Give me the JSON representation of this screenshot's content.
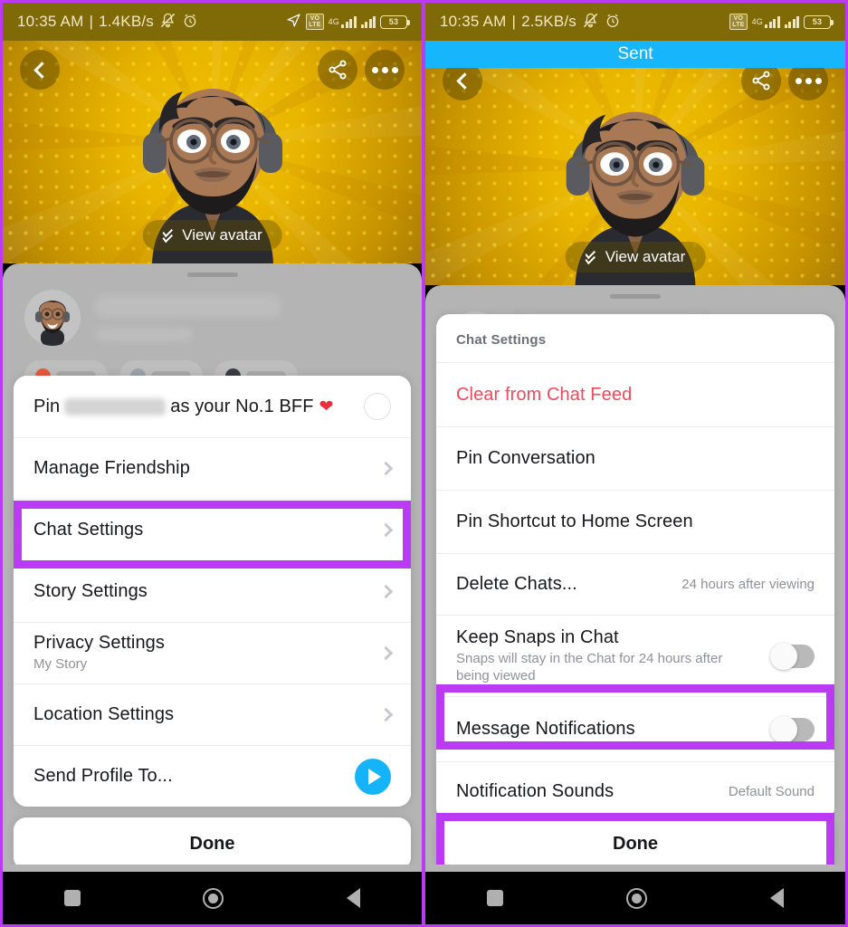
{
  "meta": {
    "accent_purple": "#BB3BF5",
    "snapchat_blue": "#15B3FA",
    "danger_red": "#F2485B"
  },
  "left_phone": {
    "status_bar": {
      "time": "10:35 AM",
      "separator": "|",
      "data_rate": "1.4KB/s",
      "mute_icon": "bell-muted-icon",
      "alarm_icon": "alarm-clock-icon",
      "location_icon": "location-arrow-icon",
      "volte_line1": "VO",
      "volte_line2": "LTE",
      "network": "4G",
      "battery_percent": "53"
    },
    "hero": {
      "back_icon": "back-chevron-icon",
      "share_icon": "share-icon",
      "more_icon": "more-options-icon",
      "view_avatar_label": "View avatar",
      "view_avatar_icon": "double-chevron-down-icon"
    },
    "menu": [
      {
        "label_prefix": "Pin",
        "label_suffix": "as your No.1 BFF",
        "name_redacted": true,
        "emoji": "❤",
        "control": "radio",
        "name": "menu-item-pin-bff"
      },
      {
        "label": "Manage Friendship",
        "control": "chevron",
        "name": "menu-item-manage-friendship"
      },
      {
        "label": "Chat Settings",
        "control": "chevron",
        "highlighted": true,
        "name": "menu-item-chat-settings"
      },
      {
        "label": "Story Settings",
        "control": "chevron",
        "name": "menu-item-story-settings"
      },
      {
        "label": "Privacy Settings",
        "sub": "My Story",
        "control": "chevron",
        "name": "menu-item-privacy-settings"
      },
      {
        "label": "Location Settings",
        "control": "chevron",
        "name": "menu-item-location-settings"
      },
      {
        "label": "Send Profile To...",
        "control": "send",
        "name": "menu-item-send-profile-to"
      }
    ],
    "done_label": "Done"
  },
  "right_phone": {
    "status_bar": {
      "time": "10:35 AM",
      "separator": "|",
      "data_rate": "2.5KB/s",
      "mute_icon": "bell-muted-icon",
      "alarm_icon": "alarm-clock-icon",
      "volte_line1": "VO",
      "volte_line2": "LTE",
      "network": "4G",
      "battery_percent": "53"
    },
    "sent_banner": "Sent",
    "hero": {
      "back_icon": "back-chevron-icon",
      "share_icon": "share-icon",
      "more_icon": "more-options-icon",
      "view_avatar_label": "View avatar",
      "view_avatar_icon": "double-chevron-down-icon"
    },
    "sheet_title": "Chat Settings",
    "menu": [
      {
        "label": "Clear from Chat Feed",
        "style": "danger",
        "name": "menu-item-clear-from-chat-feed"
      },
      {
        "label": "Pin Conversation",
        "name": "menu-item-pin-conversation"
      },
      {
        "label": "Pin Shortcut to Home Screen",
        "name": "menu-item-pin-shortcut-home-screen"
      },
      {
        "label": "Delete Chats...",
        "value": "24 hours after viewing",
        "name": "menu-item-delete-chats"
      },
      {
        "label": "Keep Snaps in Chat",
        "sub": "Snaps will stay in the Chat for 24 hours after being viewed",
        "control": "toggle",
        "toggle_on": false,
        "name": "menu-item-keep-snaps-in-chat"
      },
      {
        "label": "Message Notifications",
        "control": "toggle",
        "toggle_on": false,
        "highlighted": true,
        "name": "menu-item-message-notifications"
      },
      {
        "label": "Notification Sounds",
        "value": "Default Sound",
        "name": "menu-item-notification-sounds"
      }
    ],
    "done_label": "Done",
    "done_highlighted": true
  },
  "nav_bar": {
    "recents_icon": "square-recents-icon",
    "home_icon": "circle-home-icon",
    "back_icon": "triangle-back-icon"
  }
}
